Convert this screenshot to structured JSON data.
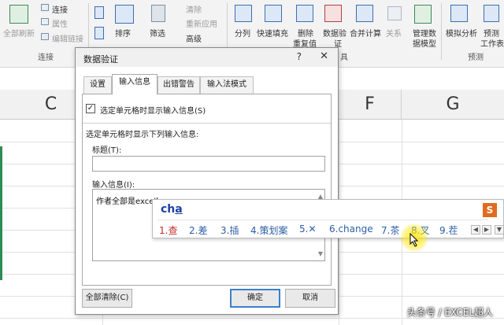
{
  "ribbon": {
    "refresh_all": "全部刷新",
    "connections": "连接",
    "properties": "属性",
    "edit_links": "编辑链接",
    "group_connections": "连接",
    "sort": "排序",
    "filter": "筛选",
    "clear": "清除",
    "reapply": "重新应用",
    "advanced": "高级",
    "text_to_columns": "分列",
    "flash_fill": "快速填充",
    "remove_duplicates_1": "删除",
    "remove_duplicates_2": "重复值",
    "data_validation_1": "数据验",
    "data_validation_2": "证",
    "consolidate": "合并计算",
    "relationships": "关系",
    "manage_data_model_1": "管理数",
    "manage_data_model_2": "据模型",
    "group_tools_tail": "具",
    "what_if_analysis": "模拟分析",
    "forecast_sheet_1": "预测",
    "forecast_sheet_2": "工作表",
    "group_forecast": "预测"
  },
  "sheet": {
    "columns": [
      "C",
      "F",
      "G"
    ]
  },
  "dialog": {
    "title": "数据验证",
    "help": "?",
    "close": "✕",
    "tabs": [
      "设置",
      "输入信息",
      "出错警告",
      "输入法模式"
    ],
    "checkbox_label": "选定单元格时显示输入信息(S)",
    "checkbox_checked": "✓",
    "section_label": "选定单元格时显示下列输入信息:",
    "title_label": "标题(T):",
    "title_value": "",
    "message_label": "输入信息(I):",
    "message_value": "作者全部是excel",
    "clear_all": "全部清除(C)",
    "ok": "确定",
    "cancel": "取消"
  },
  "ime": {
    "composition_prefix": "ch",
    "composition_tail": "a",
    "logo": "S",
    "candidates": [
      "1.查",
      "2.差",
      "3.插",
      "4.策划案",
      "5.✕",
      "6.change",
      "7.茶",
      "8.叉",
      "9.茬"
    ],
    "prev": "◀",
    "next": "▶",
    "more": "▼"
  },
  "watermark": "头条号 / EXCEL超人",
  "colors": {
    "accent": "#3c7fd0",
    "ime_first": "#c52a2a",
    "ime_other": "#2b5ea7",
    "cursor_highlight": "#ffe600"
  }
}
